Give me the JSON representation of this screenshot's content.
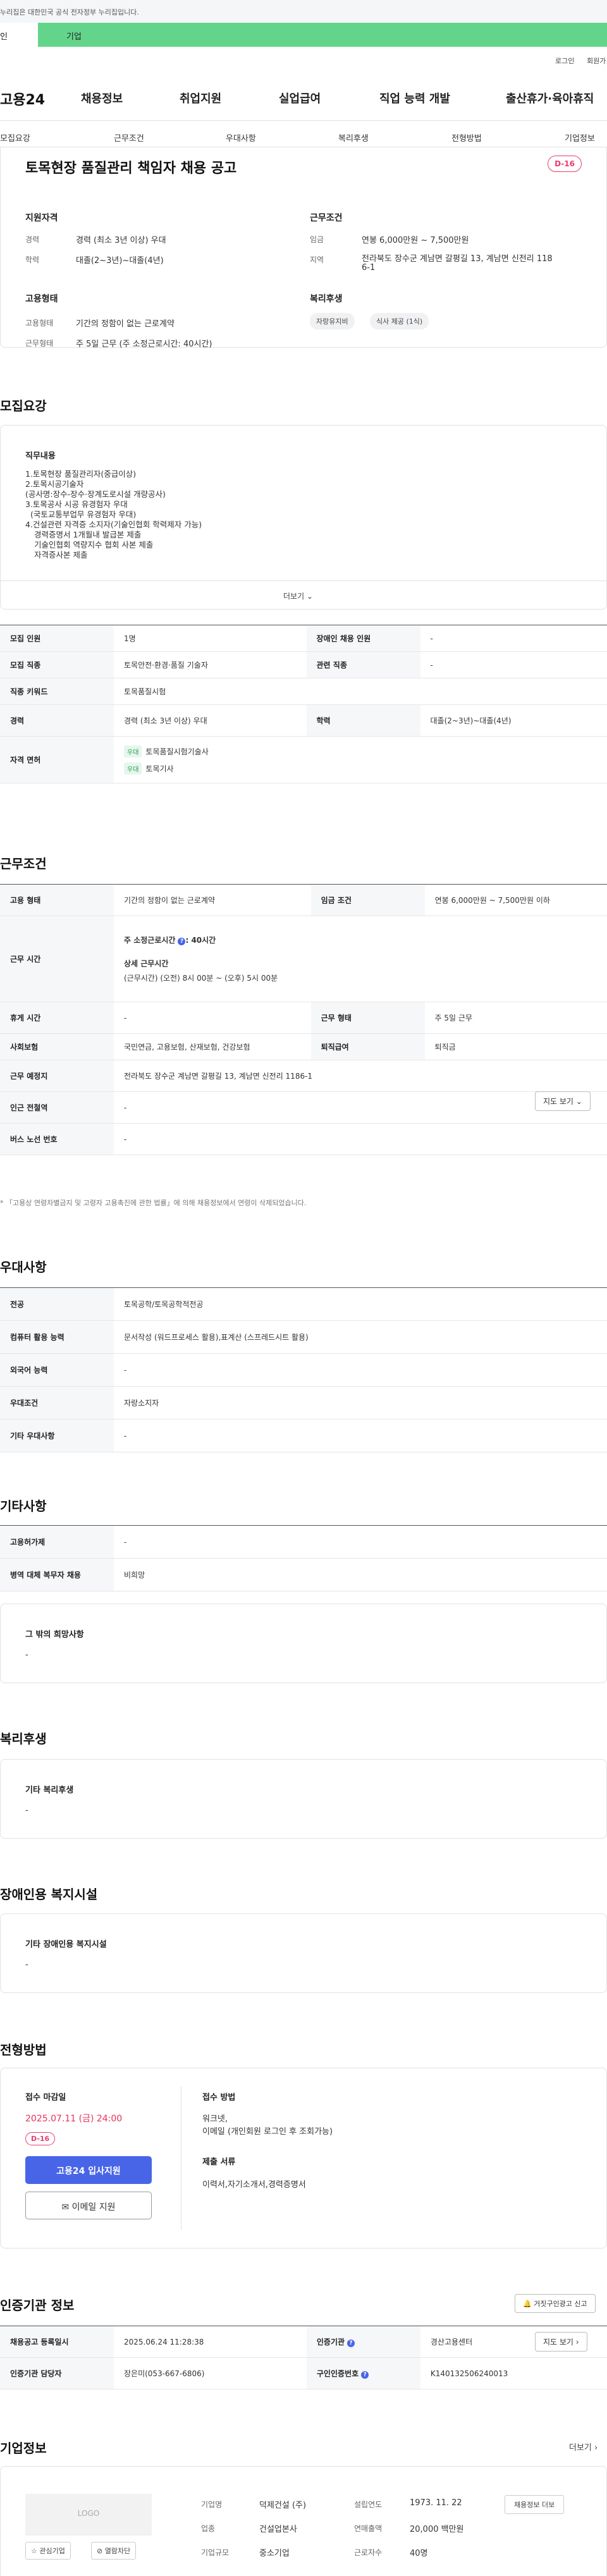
{
  "gov_notice": "누리집은 대한민국 공식 전자정부 누리집입니다.",
  "top_tabs": {
    "a": "인",
    "b": "기업"
  },
  "util": {
    "login": "로그인",
    "join": "회원가"
  },
  "logo": "고용24",
  "gnb": [
    "채용정보",
    "취업지원",
    "실업급여",
    "직업 능력 개발",
    "출산휴가·육아휴직"
  ],
  "snb": [
    "모집요강",
    "근무조건",
    "우대사항",
    "복리후생",
    "전형방법",
    "기업정보"
  ],
  "job": {
    "title": "토목현장 품질관리 책임자 채용 공고",
    "dday": "D-16",
    "summary": {
      "qual_title": "지원자격",
      "career_label": "경력",
      "career": "경력 (최소 3년 이상) 우대",
      "edu_label": "학력",
      "edu": "대졸(2~3년)~대졸(4년)",
      "cond_title": "근무조건",
      "wage_label": "임금",
      "wage": "연봉 6,000만원 ~ 7,500만원",
      "region_label": "지역",
      "region": "전라북도 장수군 계남면 갈평길 13, 계남면 신전리 118",
      "region2": "6-1",
      "emp_title": "고용형태",
      "emp_label": "고용형태",
      "emp": "기간의 정함이 없는 근로계약",
      "work_label": "근무형태",
      "work": "주 5일 근무 (주 소정근로시간: 40시간)",
      "welfare_title": "복리후생",
      "chips": [
        "자랑유지비",
        "식사 제공 (1식)"
      ]
    }
  },
  "recruit": {
    "heading": "모집요강",
    "duty_title": "직무내용",
    "duty_lines": [
      "1.토목현장 품질관리자(중급이상)",
      "2.토목시공기술자",
      "(공사명:장수-장수·장계도로시설 개량공사)",
      "3.토목공사 시공 유경험자 우대",
      "(국토교통부업무 유경험자 우대)",
      "4.건설관련 자격증 소지자(기술인협회 학력제자 가능)",
      "경력증명서 1개월내 발급본 제출",
      "기술인협회 역량지수 협회 사본 제출",
      "자격증사본 제출"
    ],
    "more": "더보기",
    "rows": {
      "people_label": "모집 인원",
      "people": "1명",
      "disabled_label": "장애인 채용 인원",
      "disabled": "-",
      "job_label": "모집 직종",
      "job": "토목안전·환경·품질 기술자",
      "rel_label": "관련 직종",
      "rel": "-",
      "kw_label": "직종 키워드",
      "kw": "토목품질시험",
      "career_label": "경력",
      "career": "경력 (최소 3년 이상) 우대",
      "edu_label": "학력",
      "edu": "대졸(2~3년)~대졸(4년)",
      "license_label": "자격 면허",
      "licenses": [
        {
          "tag": "우대",
          "name": "토목품질시험기술사"
        },
        {
          "tag": "우대",
          "name": "토목기사"
        }
      ]
    }
  },
  "condition": {
    "heading": "근무조건",
    "emp_label": "고용 형태",
    "emp": "기간의 정함이 없는 근로계약",
    "wage_label": "임금 조건",
    "wage": "연봉 6,000만원 ~ 7,500만원 이하",
    "time_label": "근무 시간",
    "time_weekly": "주 소정근로시간",
    "time_weekly_val": ": 40시간",
    "time_detail_title": "상세 근무시간",
    "time_detail": "(근무시간) (오전) 8시 00분 ~ (오후) 5시 00분",
    "rest_label": "휴게 시간",
    "rest": "-",
    "form_label": "근무 형태",
    "form": "주 5일 근무",
    "ins_label": "사회보험",
    "ins": "국민연금, 고용보험, 산재보험, 건강보험",
    "ret_label": "퇴직급여",
    "ret": "퇴직금",
    "place_label": "근무 예정지",
    "place": "전라북도 장수군 계남면 갈평길 13, 계남면 신전리 1186-1",
    "map_btn": "지도 보기",
    "subway_label": "인근 전철역",
    "subway": "-",
    "bus_label": "버스 노선 번호",
    "bus": "-",
    "note": "* 「고용상 연령차별금지 및 고령자 고용촉진에 관한 법률」에 의해 채용정보에서 연령이 삭제되었습니다."
  },
  "pref": {
    "heading": "우대사항",
    "major_label": "전공",
    "major": "토목공학/토목공학적전공",
    "pc_label": "컴퓨터 활용 능력",
    "pc": "문서작성 (워드프로세스 활용),표계산 (스프레드시트 활용)",
    "lang_label": "외국어 능력",
    "lang": "-",
    "cond_label": "우대조건",
    "cond": "자랑소지자",
    "etc_label": "기타 우대사항",
    "etc": "-"
  },
  "other": {
    "heading": "기타사항",
    "emp_label": "고용허가제",
    "emp": "-",
    "mil_label": "병역 대체 복무자 채용",
    "mil": "비희망",
    "wish_title": "그 밖의 희망사항",
    "wish": "-"
  },
  "welfare": {
    "heading": "복리후생",
    "title": "기타 복리후생",
    "value": "-"
  },
  "disabled": {
    "heading": "장애인용 복지시설",
    "title": "기타 장애인용 복지시설",
    "value": "-"
  },
  "selection": {
    "heading": "전형방법",
    "deadline_title": "접수 마감일",
    "deadline": "2025.07.11 (금) 24:00",
    "dday": "D-16",
    "apply": "고용24 입사지원",
    "mail": "이메일 지원",
    "method_title": "접수 방법",
    "method1": "워크넷,",
    "method2": "이메일 (개인회원 로그인 후 조회가능)",
    "docs_title": "제출 서류",
    "docs": "이력서,자기소개서,경력증명서"
  },
  "agency": {
    "heading": "인증기관 정보",
    "report_btn": "거짓구인광고 신고",
    "reg_label": "채용공고 등록일시",
    "reg": "2025.06.24 11:28:38",
    "org_label": "인증기관",
    "org": "경산고용센터",
    "map_btn": "지도 보기",
    "mgr_label": "인증기관 담당자",
    "mgr": "장은미(053-667-6806)",
    "num_label": "구인인증번호",
    "num": "K140132506240013"
  },
  "company": {
    "heading": "기업정보",
    "more": "더보기",
    "logo": "LOGO",
    "fav": "관심기업",
    "block": "열람차단",
    "name_label": "기업명",
    "name": "덕제건설 (주)",
    "ind_label": "업종",
    "ind": "건설업본사",
    "size_label": "기업규모",
    "size": "중소기업",
    "est_label": "설립연도",
    "est": "1973. 11. 22",
    "sales_label": "연매출액",
    "sales": "20,000 백만원",
    "staff_label": "근로자수",
    "staff": "40명",
    "jobs_btn": "채용정보 더보"
  }
}
